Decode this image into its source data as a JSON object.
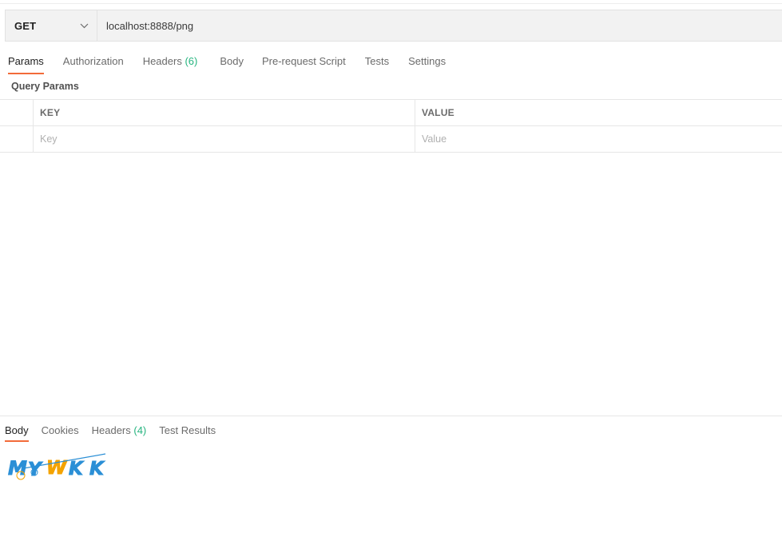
{
  "request": {
    "method": "GET",
    "url": "localhost:8888/png"
  },
  "request_tabs": [
    {
      "label": "Params",
      "count": "",
      "active": true
    },
    {
      "label": "Authorization",
      "count": "",
      "active": false
    },
    {
      "label": "Headers",
      "count": "(6)",
      "active": false
    },
    {
      "label": "Body",
      "count": "",
      "active": false
    },
    {
      "label": "Pre-request Script",
      "count": "",
      "active": false
    },
    {
      "label": "Tests",
      "count": "",
      "active": false
    },
    {
      "label": "Settings",
      "count": "",
      "active": false
    }
  ],
  "query_params": {
    "title": "Query Params",
    "columns": {
      "key": "KEY",
      "value": "VALUE"
    },
    "placeholders": {
      "key": "Key",
      "value": "Value"
    }
  },
  "response_tabs": [
    {
      "label": "Body",
      "count": "",
      "active": true
    },
    {
      "label": "Cookies",
      "count": "",
      "active": false
    },
    {
      "label": "Headers",
      "count": "(4)",
      "active": false
    },
    {
      "label": "Test Results",
      "count": "",
      "active": false
    }
  ],
  "response_image": {
    "captcha_text": "MYWKK",
    "colors": [
      "#2b8fd6",
      "#2b8fd6",
      "#f4a300",
      "#2b8fd6",
      "#2b8fd6"
    ]
  },
  "colors": {
    "accent": "#f26b3a",
    "count": "#26b47f"
  }
}
